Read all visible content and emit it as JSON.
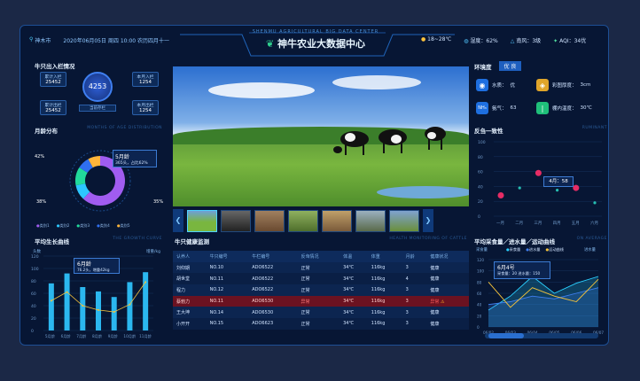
{
  "header": {
    "location": "神木市",
    "date": "2020年06月05日",
    "weekday": "周四",
    "time": "10:00",
    "lunar": "农历四月十一",
    "title_en": "SHENMU AGRICULTURAL BIG DATA CENTER",
    "title": "神牛农业大数据中心",
    "temp": "18~28℃",
    "humidity_label": "湿度",
    "humidity": "62%",
    "wind_label": "南风",
    "wind": "3级",
    "aqi": "AQI：34优"
  },
  "stats": {
    "title": "牛只出入栏情况",
    "center_value": "4253",
    "center_label": "当前存栏",
    "cards": [
      {
        "label": "累计入栏",
        "value": "25452"
      },
      {
        "label": "本月入栏",
        "value": "1254"
      },
      {
        "label": "累计出栏",
        "value": "25452"
      },
      {
        "label": "本月出栏",
        "value": "1254"
      }
    ]
  },
  "env": {
    "title": "环境度",
    "badge": "优 良",
    "items": [
      {
        "label": "水质：",
        "value": "优"
      },
      {
        "label": "彩图厚度：",
        "value": "3cm"
      },
      {
        "label": "氨气：",
        "value": "63"
      },
      {
        "label": "棚内温度：",
        "value": "30℃"
      }
    ]
  },
  "age": {
    "title": "月龄分布",
    "title_en": "MONTHS OF AGE DISTRIBUTION",
    "tooltip_title": "5月龄",
    "tooltip_text": "365头，占比62%",
    "pct_left": "42%",
    "pct_lower": "38%",
    "pct_right": "35%",
    "legend": [
      "类别1",
      "类别2",
      "类别3",
      "类别4",
      "类别5"
    ],
    "chart_data": {
      "type": "pie",
      "values": [
        62,
        10,
        12,
        8,
        8
      ]
    }
  },
  "disease": {
    "title": "反刍一致性",
    "title_en": "RUMINANT",
    "tooltip": "4月：58",
    "chart_data": {
      "type": "scatter",
      "categories": [
        "一月",
        "二月",
        "三月",
        "四月",
        "五月",
        "六月"
      ],
      "ylim": [
        0,
        100
      ],
      "points": [
        {
          "x": "一月",
          "y": 28
        },
        {
          "x": "二月",
          "y": 38
        },
        {
          "x": "三月",
          "y": 58
        },
        {
          "x": "四月",
          "y": 35
        },
        {
          "x": "五月",
          "y": 38
        },
        {
          "x": "六月",
          "y": 18
        }
      ],
      "yticks": [
        "0",
        "20",
        "40",
        "60",
        "80",
        "100"
      ]
    }
  },
  "growth": {
    "title": "平均生长曲线",
    "title_en": "THE GROWTH CURVE",
    "ylabel": "头数",
    "ylabel2": "增重/kg",
    "tooltip_title": "6月龄",
    "tooltip_text": "76.2头，增重42kg",
    "chart_data": {
      "type": "bar",
      "categories": [
        "5月龄",
        "6月龄",
        "7月龄",
        "8月龄",
        "9月龄",
        "10月龄",
        "11月龄"
      ],
      "values": [
        76,
        92,
        70,
        63,
        54,
        78,
        94
      ],
      "line": [
        48,
        62,
        40,
        33,
        30,
        42,
        78
      ],
      "ylim": [
        0,
        120
      ],
      "yticks": [
        "0",
        "20",
        "40",
        "60",
        "80",
        "100",
        "120"
      ]
    }
  },
  "health": {
    "title": "牛只健康监测",
    "title_en": "HEALTH MONITORING OF CATTLE",
    "columns": [
      "认养人",
      "牛只编号",
      "牛栏编号",
      "反刍情况",
      "体温",
      "体重",
      "月龄",
      "健康状况"
    ],
    "rows": [
      [
        "刘仰期",
        "NO.10",
        "ADO6522",
        "正常",
        "34℃",
        "116kg",
        "3",
        "健康"
      ],
      [
        "胡世堂",
        "NO.11",
        "ADO6522",
        "正常",
        "34℃",
        "116kg",
        "4",
        "健康"
      ],
      [
        "程力",
        "NO.12",
        "ADO6522",
        "正常",
        "34℃",
        "116kg",
        "3",
        "健康"
      ],
      [
        "蔡勃力",
        "NO.11",
        "ADO6530",
        "异常",
        "34℃",
        "116kg",
        "3",
        "异常"
      ],
      [
        "王大坤",
        "NO.14",
        "ADO6530",
        "正常",
        "34℃",
        "116kg",
        "3",
        "健康"
      ],
      [
        "小开开",
        "NO.15",
        "ADO6623",
        "正常",
        "34℃",
        "116kg",
        "3",
        "健康"
      ]
    ]
  },
  "feed": {
    "title": "平均采食量／进水量／运动曲线",
    "title_en": "ON AVERAGE",
    "ylabel": "采食量",
    "ylabel2": "进水量",
    "legend": [
      "采食量",
      "进水量",
      "运动曲线"
    ],
    "tooltip_title": "6月4号",
    "tooltip_text": "采食量：20  进水量：150",
    "chart_data": {
      "type": "area",
      "categories": [
        "06/02",
        "06/03",
        "06/04",
        "06/05",
        "06/06",
        "06/07"
      ],
      "series": [
        {
          "name": "采食量",
          "values": [
            30,
            55,
            90,
            60,
            78,
            90
          ]
        },
        {
          "name": "进水量",
          "values": [
            40,
            45,
            55,
            50,
            60,
            70
          ]
        },
        {
          "name": "运动曲线",
          "values": [
            80,
            35,
            70,
            55,
            45,
            85
          ]
        }
      ],
      "ylim": [
        0,
        120
      ],
      "yticks": [
        "0",
        "20",
        "40",
        "60",
        "80",
        "100",
        "120"
      ]
    }
  }
}
